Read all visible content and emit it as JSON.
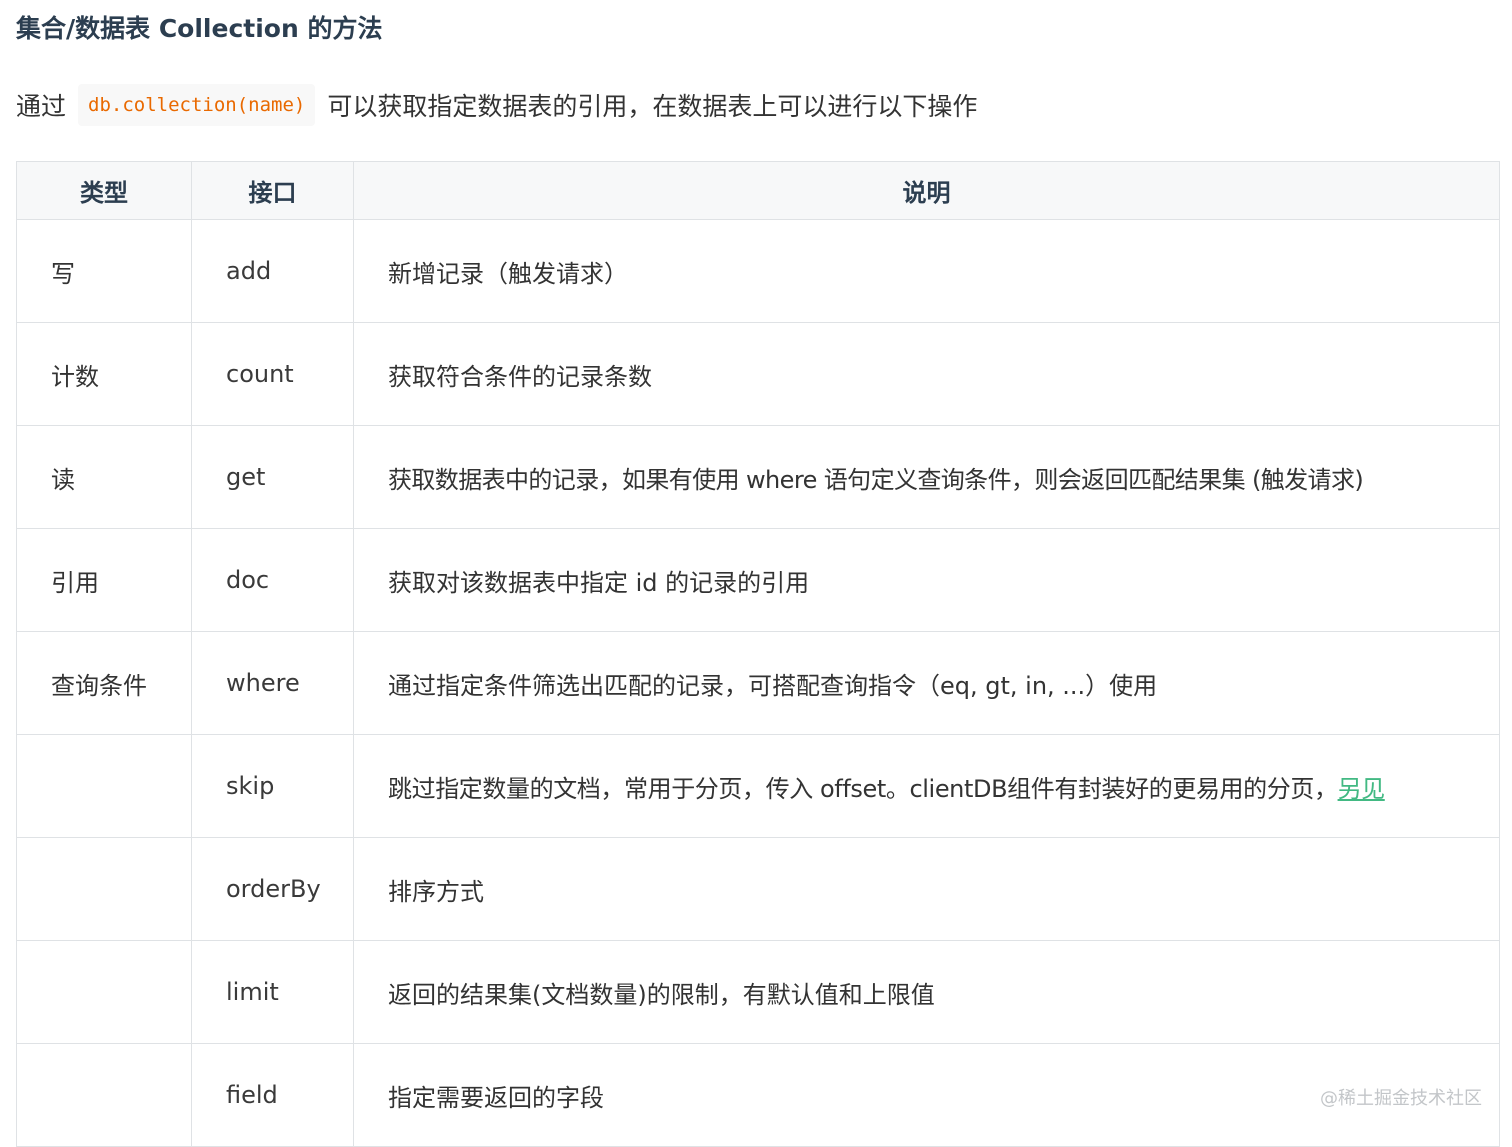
{
  "title": "集合/数据表 Collection 的方法",
  "intro": {
    "before": "通过",
    "code": "db.collection(name)",
    "after": "可以获取指定数据表的引用，在数据表上可以进行以下操作"
  },
  "table": {
    "headers": [
      "类型",
      "接口",
      "说明"
    ],
    "rows": [
      {
        "type": "写",
        "api": "add",
        "desc": "新增记录（触发请求）"
      },
      {
        "type": "计数",
        "api": "count",
        "desc": "获取符合条件的记录条数"
      },
      {
        "type": "读",
        "api": "get",
        "desc": "获取数据表中的记录，如果有使用 where 语句定义查询条件，则会返回匹配结果集 (触发请求)"
      },
      {
        "type": "引用",
        "api": "doc",
        "desc": "获取对该数据表中指定 id 的记录的引用"
      },
      {
        "type": "查询条件",
        "api": "where",
        "desc": "通过指定条件筛选出匹配的记录，可搭配查询指令（eq, gt, in, ...）使用"
      },
      {
        "type": "",
        "api": "skip",
        "desc": "跳过指定数量的文档，常用于分页，传入 offset。clientDB组件有封装好的更易用的分页，",
        "link": "另见"
      },
      {
        "type": "",
        "api": "orderBy",
        "desc": "排序方式"
      },
      {
        "type": "",
        "api": "limit",
        "desc": "返回的结果集(文档数量)的限制，有默认值和上限值"
      },
      {
        "type": "",
        "api": "field",
        "desc": "指定需要返回的字段"
      }
    ]
  },
  "watermark": "@稀土掘金技术社区",
  "colors": {
    "link": "#42b983",
    "code": "#e96900",
    "code_bg": "#f8f8f8",
    "border": "#dfe2e5",
    "header_bg": "#f7f8f9"
  }
}
